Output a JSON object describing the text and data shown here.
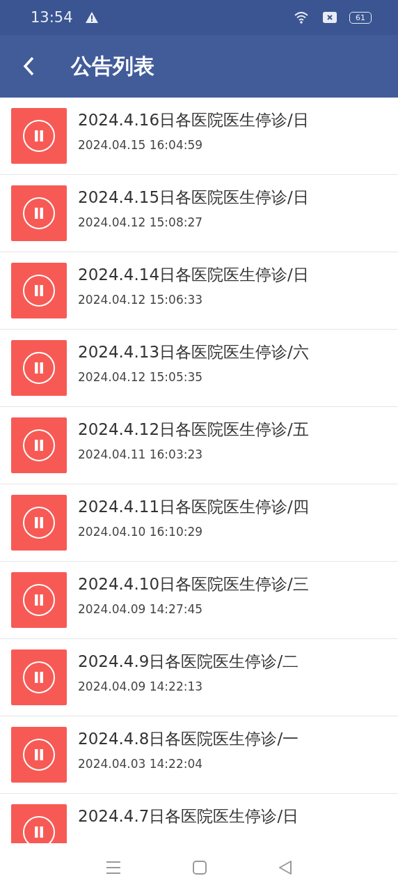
{
  "status_bar": {
    "time": "13:54",
    "battery": "61"
  },
  "header": {
    "title": "公告列表"
  },
  "notices": [
    {
      "title": "2024.4.16日各医院医生停诊/日",
      "date": "2024.04.15 16:04:59"
    },
    {
      "title": "2024.4.15日各医院医生停诊/日",
      "date": "2024.04.12 15:08:27"
    },
    {
      "title": "2024.4.14日各医院医生停诊/日",
      "date": "2024.04.12 15:06:33"
    },
    {
      "title": "2024.4.13日各医院医生停诊/六",
      "date": "2024.04.12 15:05:35"
    },
    {
      "title": "2024.4.12日各医院医生停诊/五",
      "date": "2024.04.11 16:03:23"
    },
    {
      "title": "2024.4.11日各医院医生停诊/四",
      "date": "2024.04.10 16:10:29"
    },
    {
      "title": "2024.4.10日各医院医生停诊/三",
      "date": "2024.04.09 14:27:45"
    },
    {
      "title": "2024.4.9日各医院医生停诊/二",
      "date": "2024.04.09 14:22:13"
    },
    {
      "title": "2024.4.8日各医院医生停诊/一",
      "date": "2024.04.03 14:22:04"
    },
    {
      "title": "2024.4.7日各医院医生停诊/日"
    }
  ]
}
